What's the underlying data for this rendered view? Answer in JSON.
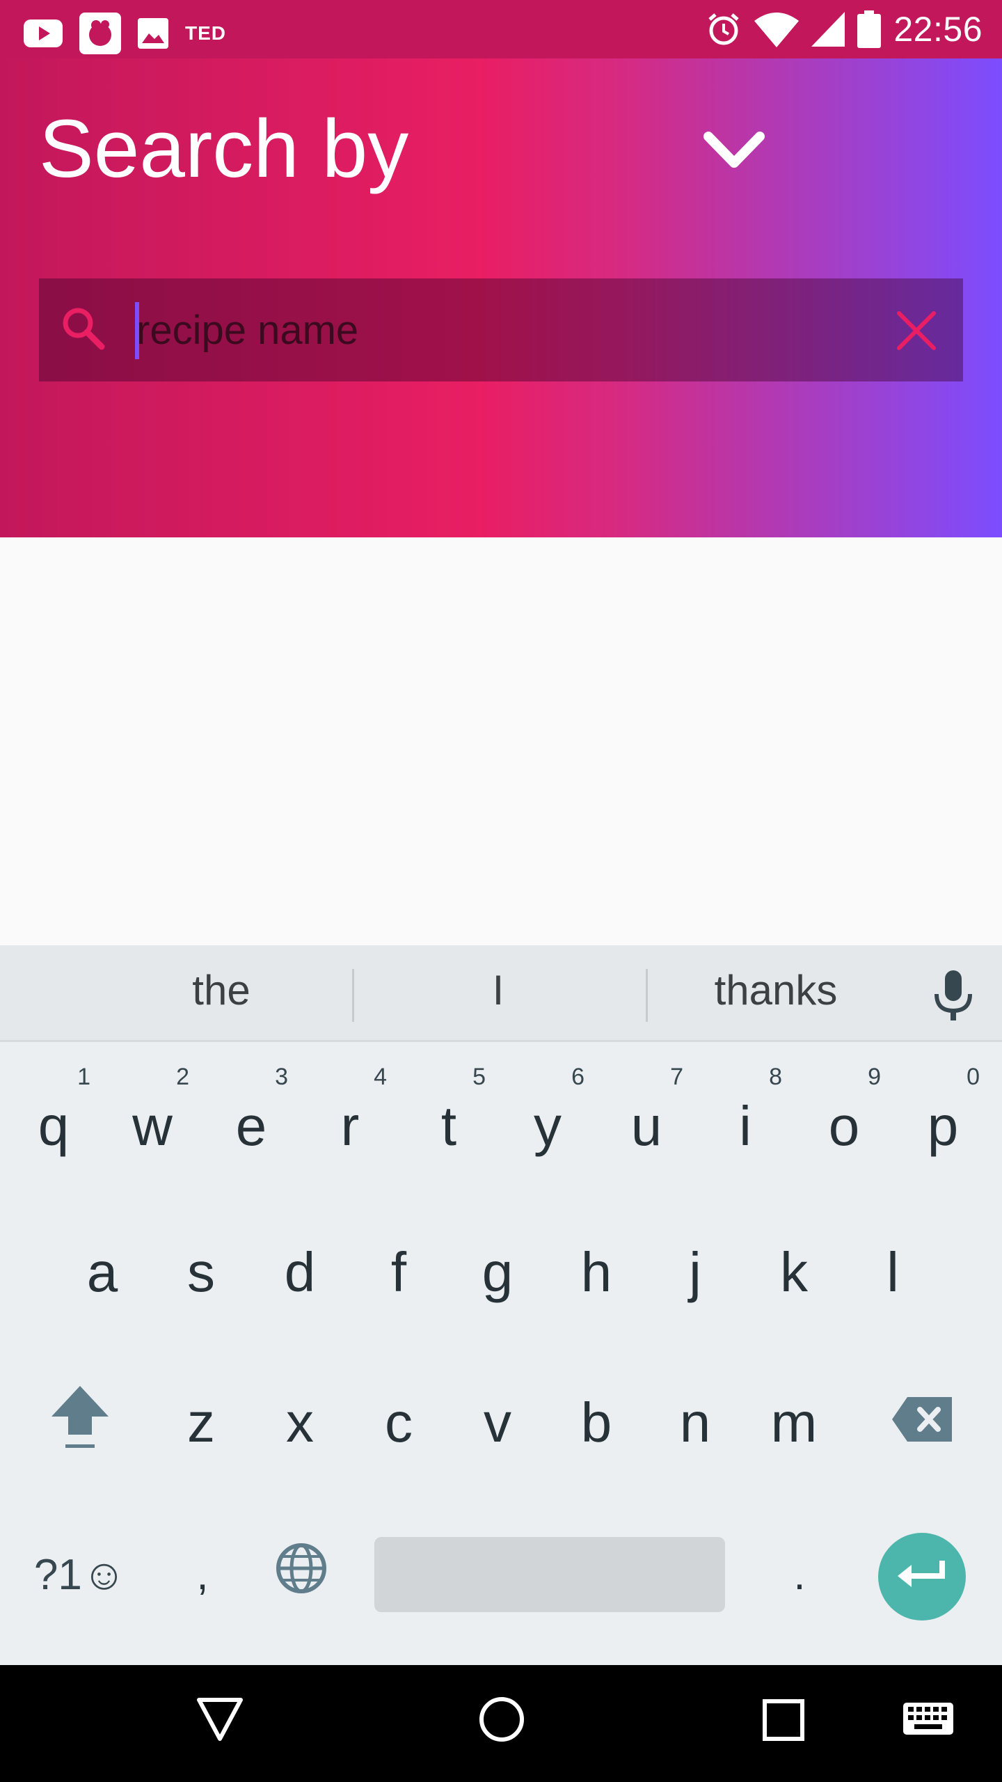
{
  "status_bar": {
    "time": "22:56",
    "ted_label": "TED",
    "left_icons": [
      "youtube-icon",
      "app-icon",
      "image-icon",
      "ted-icon"
    ],
    "right_icons": [
      "alarm-icon",
      "wifi-icon",
      "signal-icon",
      "battery-icon"
    ]
  },
  "header": {
    "title": "Search by",
    "dropdown_icon": "chevron-down-icon",
    "colors": {
      "start": "#c2185b",
      "middle": "#e91e63",
      "end": "#7c4dff"
    }
  },
  "search": {
    "placeholder": "recipe name",
    "value": ""
  },
  "keyboard": {
    "suggestions": [
      "the",
      "I",
      "thanks"
    ],
    "row1": [
      {
        "key": "q",
        "hint": "1"
      },
      {
        "key": "w",
        "hint": "2"
      },
      {
        "key": "e",
        "hint": "3"
      },
      {
        "key": "r",
        "hint": "4"
      },
      {
        "key": "t",
        "hint": "5"
      },
      {
        "key": "y",
        "hint": "6"
      },
      {
        "key": "u",
        "hint": "7"
      },
      {
        "key": "i",
        "hint": "8"
      },
      {
        "key": "o",
        "hint": "9"
      },
      {
        "key": "p",
        "hint": "0"
      }
    ],
    "row2": [
      "a",
      "s",
      "d",
      "f",
      "g",
      "h",
      "j",
      "k",
      "l"
    ],
    "row3": [
      "z",
      "x",
      "c",
      "v",
      "b",
      "n",
      "m"
    ],
    "symbols_label": "?1☺",
    "comma": ",",
    "period": ".",
    "accent": "#4db6ac"
  },
  "nav_bar": {
    "icons": [
      "back-icon",
      "home-icon",
      "recents-icon",
      "keyboard-switch-icon"
    ]
  }
}
